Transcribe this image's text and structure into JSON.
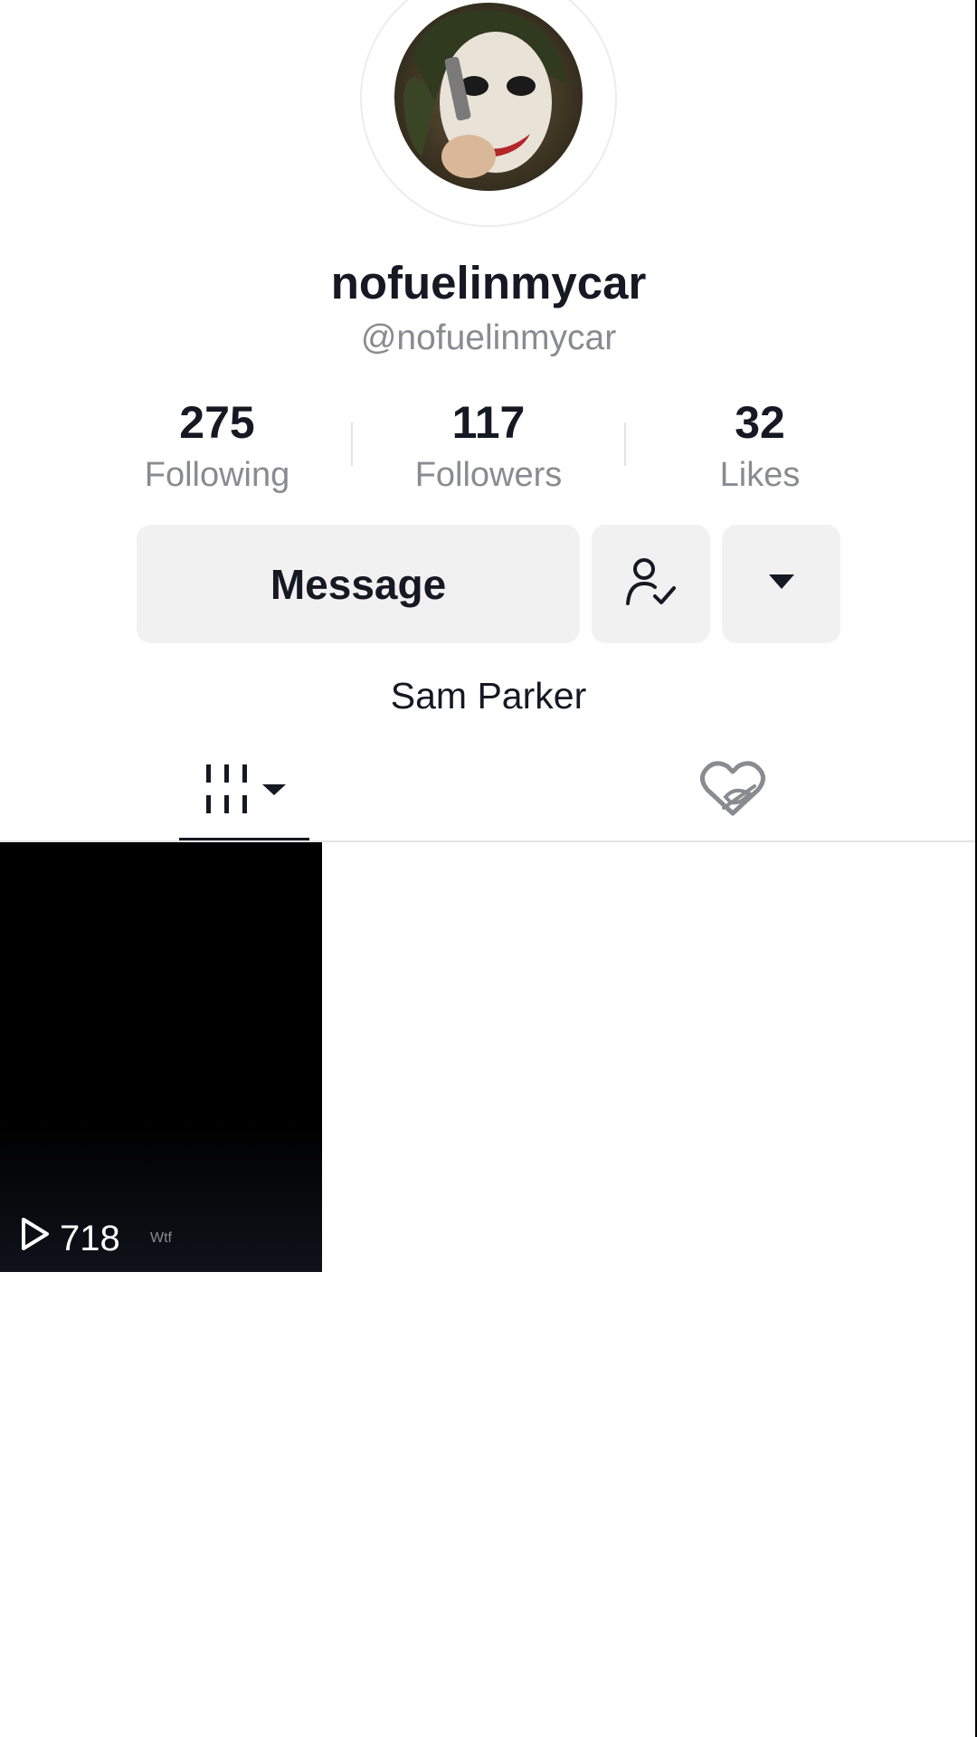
{
  "profile": {
    "display_name": "nofuelinmycar",
    "handle": "@nofuelinmycar",
    "bio_name": "Sam Parker"
  },
  "stats": [
    {
      "value": "275",
      "label": "Following"
    },
    {
      "value": "117",
      "label": "Followers"
    },
    {
      "value": "32",
      "label": "Likes"
    }
  ],
  "actions": {
    "message_label": "Message",
    "following_icon": "user-check-icon",
    "more_icon": "caret-down-icon"
  },
  "tabs": [
    {
      "icon": "videos-grid-icon",
      "selected": true
    },
    {
      "icon": "liked-hidden-icon",
      "selected": false
    }
  ],
  "videos": [
    {
      "views": "718",
      "caption": "Wtf"
    }
  ],
  "colors": {
    "text_primary": "#161823",
    "text_secondary": "#8a8b91",
    "button_bg": "#f1f1f2",
    "divider": "#e3e3e4"
  }
}
